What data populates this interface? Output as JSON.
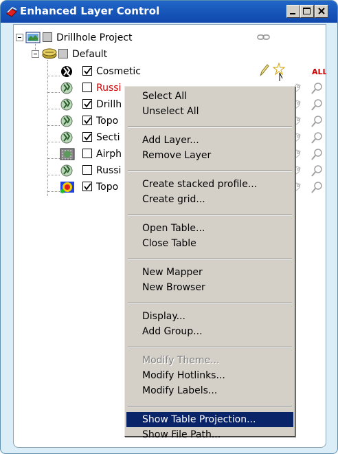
{
  "window": {
    "title": "Enhanced Layer Control"
  },
  "titlebar_buttons": [
    "minimize",
    "maximize",
    "close"
  ],
  "tree": {
    "root": {
      "label": "Drillhole Project",
      "checked": false
    },
    "group": {
      "label": "Default",
      "checked": false
    },
    "layers": [
      {
        "label": "Cosmetic",
        "checked": true,
        "red": false
      },
      {
        "label": "Russi",
        "checked": false,
        "red": true
      },
      {
        "label": "Drillh",
        "checked": true,
        "red": false
      },
      {
        "label": "Topo",
        "checked": true,
        "red": false
      },
      {
        "label": "Secti",
        "checked": true,
        "red": false
      },
      {
        "label": "Airph",
        "checked": false,
        "red": false
      },
      {
        "label": "Russi",
        "checked": false,
        "red": false
      },
      {
        "label": "Topo",
        "checked": true,
        "red": false
      }
    ]
  },
  "context_menu": {
    "groups": [
      [
        "Select All",
        "Unselect All"
      ],
      [
        "Add Layer...",
        "Remove Layer"
      ],
      [
        "Create stacked profile...",
        "Create grid..."
      ],
      [
        "Open Table...",
        "Close Table"
      ],
      [
        "New Mapper",
        "New Browser"
      ],
      [
        "Display...",
        "Add Group..."
      ],
      [
        "Modify Theme...",
        "Modify Hotlinks...",
        "Modify Labels..."
      ],
      [
        "Show Table Projection...",
        "Show File Path..."
      ]
    ],
    "disabled": [
      "Modify Theme..."
    ],
    "highlighted": "Show Table Projection..."
  },
  "colors": {
    "titlebar": "#1a5bbd",
    "frame": "#dbeef7",
    "menu_bg": "#d4d0c8",
    "highlight": "#0a246a",
    "red_label": "#d00000"
  },
  "icons": [
    "layer-control-icon",
    "globe-icon",
    "map-icon",
    "group-layers-icon",
    "link-icon",
    "edit-pencil-icon",
    "selectable-star-icon",
    "all-label-icon",
    "label-tag-icon",
    "zoom-magnifier-icon"
  ]
}
